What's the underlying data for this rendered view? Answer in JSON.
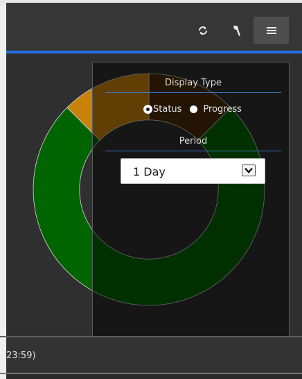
{
  "header": {
    "refresh_icon": "refresh-icon",
    "wrench_icon": "wrench-icon",
    "menu_icon": "hamburger-menu-icon"
  },
  "colors": {
    "accent": "#1f6fe6",
    "ok_green": "#006400",
    "warning_orange": "#c8820a",
    "unknown_brown": "#4a2a08"
  },
  "chart_data": {
    "type": "pie",
    "values": [
      12.5,
      75,
      12.5
    ],
    "colors": [
      "#4a2a08",
      "#006400",
      "#c8820a"
    ],
    "inner_radius_ratio": 0.6
  },
  "panel": {
    "display_type_title": "Display Type",
    "status_label": "Status",
    "progress_label": "Progress",
    "selected_display": "Status",
    "period_title": "Period",
    "period_value": "1 Day"
  },
  "footer": {
    "text": "23:59)"
  }
}
